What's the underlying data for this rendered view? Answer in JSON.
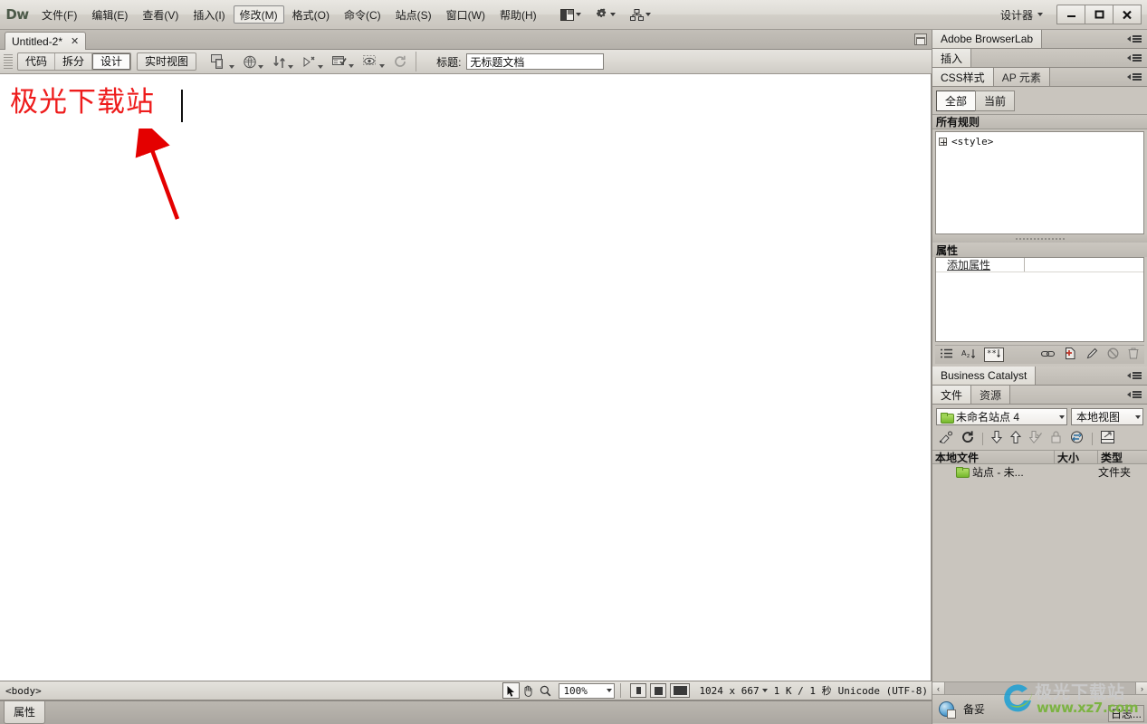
{
  "app": {
    "logo": "Dw",
    "workspace": "设计器"
  },
  "menu": {
    "items": [
      {
        "label": "文件(F)",
        "active": false
      },
      {
        "label": "编辑(E)",
        "active": false
      },
      {
        "label": "查看(V)",
        "active": false
      },
      {
        "label": "插入(I)",
        "active": false
      },
      {
        "label": "修改(M)",
        "active": true
      },
      {
        "label": "格式(O)",
        "active": false
      },
      {
        "label": "命令(C)",
        "active": false
      },
      {
        "label": "站点(S)",
        "active": false
      },
      {
        "label": "窗口(W)",
        "active": false
      },
      {
        "label": "帮助(H)",
        "active": false
      }
    ],
    "icons": [
      "layout-icon",
      "gear-icon",
      "site-tree-icon"
    ]
  },
  "window_controls": {
    "minimize": "—",
    "maximize": "❐",
    "close": "✕"
  },
  "document_tab": {
    "title": "Untitled-2*",
    "close": "✕"
  },
  "doc_toolbar": {
    "view_buttons": [
      {
        "label": "代码",
        "selected": false
      },
      {
        "label": "拆分",
        "selected": false
      },
      {
        "label": "设计",
        "selected": true
      }
    ],
    "live_view": "实时视图",
    "icons": [
      "multiscreen-preview-icon",
      "preview-in-browser-icon",
      "file-management-icon",
      "check-browser-compat-icon",
      "visual-aids-icon",
      "view-options-icon",
      "refresh-icon"
    ],
    "title_label": "标题:",
    "title_value": "无标题文档"
  },
  "canvas": {
    "text": "极光下载站",
    "text_color": "#ee1c1c",
    "arrow_color": "#e40000"
  },
  "status_bar": {
    "tag_selector": "<body>",
    "tools": [
      "select-tool-icon",
      "hand-tool-icon",
      "zoom-tool-icon"
    ],
    "zoom": "100%",
    "window_sizes": [
      "small-window-icon",
      "medium-window-icon",
      "large-window-icon"
    ],
    "dimensions": "1024 x 667",
    "download": "1 K / 1 秒",
    "encoding": "Unicode (UTF-8)"
  },
  "properties_strip": {
    "tab": "属性"
  },
  "dock": {
    "browserlab": {
      "title": "Adobe BrowserLab"
    },
    "insert": {
      "title": "插入"
    },
    "css": {
      "tabs": [
        {
          "label": "CSS样式",
          "selected": true
        },
        {
          "label": "AP 元素",
          "selected": false
        }
      ],
      "buttons": [
        {
          "label": "全部",
          "selected": true
        },
        {
          "label": "当前",
          "selected": false
        }
      ],
      "section_title": "所有规则",
      "rules": [
        {
          "label": "<style>",
          "expandable": true
        }
      ],
      "properties_title": "属性",
      "property_rows": [
        {
          "key": "添加属性",
          "value": ""
        }
      ],
      "iconbar_left": [
        "category-view-icon",
        "list-view-icon",
        "set-properties-icon"
      ],
      "iconbar_right": [
        "attach-stylesheet-icon",
        "new-css-rule-icon",
        "edit-rule-icon",
        "disable-property-icon",
        "delete-property-icon"
      ]
    },
    "business_catalyst": {
      "title": "Business Catalyst"
    },
    "files": {
      "tabs": [
        {
          "label": "文件",
          "selected": true
        },
        {
          "label": "资源",
          "selected": false
        }
      ],
      "site_name": "未命名站点 4",
      "view_mode": "本地视图",
      "toolbar_icons": [
        "connect-remote-icon",
        "refresh-icon",
        "get-files-icon",
        "put-files-icon",
        "check-out-icon",
        "check-in-icon",
        "synchronize-icon",
        "expand-panel-icon"
      ],
      "columns": [
        "本地文件",
        "大小",
        "类型"
      ],
      "rows": [
        {
          "name": "站点 - 未...",
          "size": "",
          "type": "文件夹",
          "icon": "folder-icon"
        }
      ]
    },
    "bottom_status": {
      "label": "备妥",
      "log": "日志..."
    }
  },
  "watermark": {
    "title": "极光下载站",
    "url": "www.xz7.com"
  }
}
